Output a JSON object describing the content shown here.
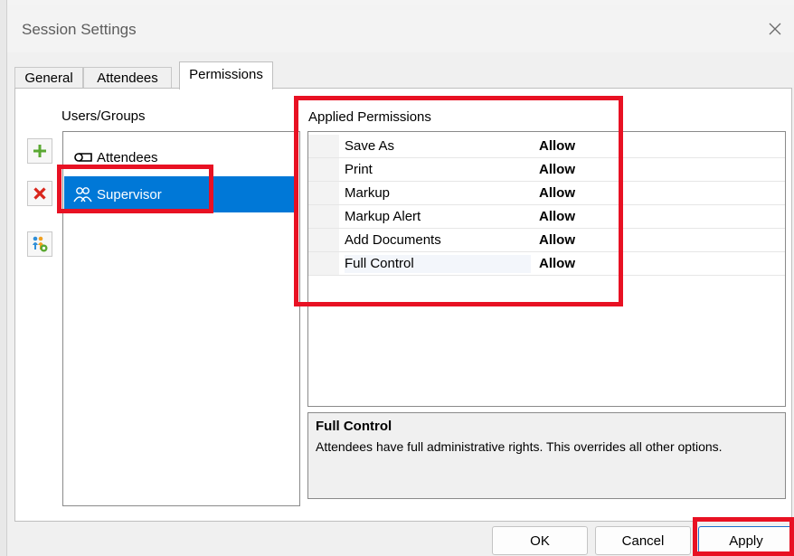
{
  "window": {
    "title": "Session Settings"
  },
  "tabs": [
    {
      "label": "General",
      "active": false
    },
    {
      "label": "Attendees",
      "active": false
    },
    {
      "label": "Permissions",
      "active": true
    }
  ],
  "users_groups": {
    "label": "Users/Groups",
    "items": [
      {
        "label": "Attendees",
        "icon": "key-icon",
        "selected": false
      },
      {
        "label": "Supervisor",
        "icon": "group-icon",
        "selected": true
      }
    ]
  },
  "toolbar": {
    "add_icon": "plus-icon",
    "remove_icon": "x-icon",
    "manage_icon": "users-gear-icon"
  },
  "permissions": {
    "label": "Applied Permissions",
    "rows": [
      {
        "name": "Save As",
        "value": "Allow"
      },
      {
        "name": "Print",
        "value": "Allow"
      },
      {
        "name": "Markup",
        "value": "Allow"
      },
      {
        "name": "Markup Alert",
        "value": "Allow"
      },
      {
        "name": "Add Documents",
        "value": "Allow"
      },
      {
        "name": "Full Control",
        "value": "Allow"
      }
    ]
  },
  "description": {
    "title": "Full Control",
    "text": "Attendees have full administrative rights. This overrides all other options."
  },
  "buttons": {
    "ok": "OK",
    "cancel": "Cancel",
    "apply": "Apply"
  },
  "colors": {
    "selection": "#0078d7",
    "highlight": "#e81123",
    "add": "#5aa832",
    "remove": "#d9261c"
  }
}
